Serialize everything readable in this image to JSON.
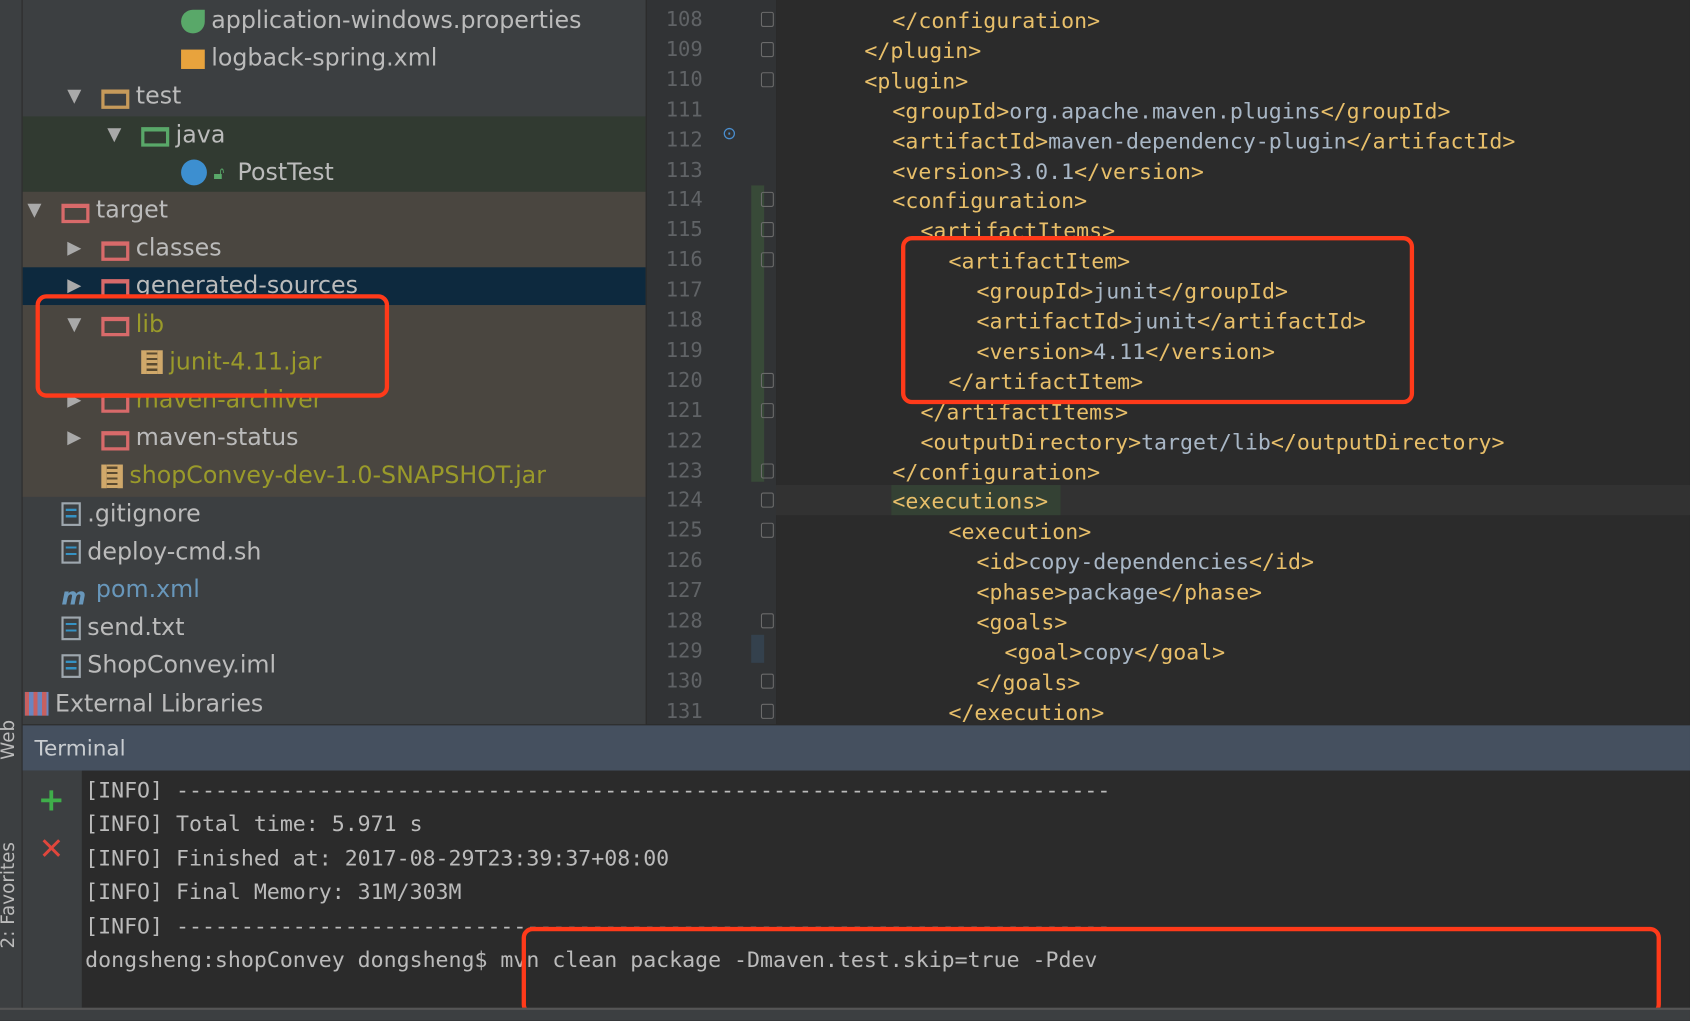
{
  "side_tools": {
    "web": "Web",
    "favorites": "2: Favorites"
  },
  "project_tree": [
    {
      "label": "application-windows.properties",
      "depth": 3,
      "icon": "spring-properties-icon",
      "arrow": "",
      "color": ""
    },
    {
      "label": "logback-spring.xml",
      "depth": 3,
      "icon": "xml-file-icon",
      "arrow": "",
      "color": ""
    },
    {
      "label": "test",
      "depth": 1,
      "icon": "folder-tan-icon",
      "arrow": "down",
      "color": ""
    },
    {
      "label": "java",
      "depth": 2,
      "icon": "folder-green-icon",
      "arrow": "down",
      "color": ""
    },
    {
      "label": "PostTest",
      "depth": 3,
      "icon": "test-class-icon",
      "arrow": "",
      "color": ""
    },
    {
      "label": "target",
      "depth": 0,
      "icon": "folder-red-icon",
      "arrow": "down",
      "color": ""
    },
    {
      "label": "classes",
      "depth": 1,
      "icon": "folder-red-icon",
      "arrow": "right",
      "color": ""
    },
    {
      "label": "generated-sources",
      "depth": 1,
      "icon": "folder-red-icon",
      "arrow": "right",
      "color": ""
    },
    {
      "label": "lib",
      "depth": 1,
      "icon": "folder-red-icon",
      "arrow": "down",
      "color": "olive"
    },
    {
      "label": "junit-4.11.jar",
      "depth": 2,
      "icon": "jar-icon",
      "arrow": "",
      "color": "olive"
    },
    {
      "label": "maven-archiver",
      "depth": 1,
      "icon": "folder-red-icon",
      "arrow": "right",
      "color": "olive"
    },
    {
      "label": "maven-status",
      "depth": 1,
      "icon": "folder-red-icon",
      "arrow": "right",
      "color": ""
    },
    {
      "label": "shopConvey-dev-1.0-SNAPSHOT.jar",
      "depth": 1,
      "icon": "jar-icon",
      "arrow": "",
      "color": "olive",
      "noarrow_slot": true
    },
    {
      "label": ".gitignore",
      "depth": 0,
      "icon": "text-file-icon",
      "arrow": "",
      "color": ""
    },
    {
      "label": "deploy-cmd.sh",
      "depth": 0,
      "icon": "text-file-icon",
      "arrow": "",
      "color": ""
    },
    {
      "label": "pom.xml",
      "depth": 0,
      "icon": "maven-icon",
      "arrow": "",
      "color": "blue"
    },
    {
      "label": "send.txt",
      "depth": 0,
      "icon": "text-file-icon",
      "arrow": "",
      "color": ""
    },
    {
      "label": "ShopConvey.iml",
      "depth": 0,
      "icon": "iml-file-icon",
      "arrow": "",
      "color": ""
    },
    {
      "label": "External Libraries",
      "depth": -1,
      "icon": "library-icon",
      "arrow": "",
      "color": ""
    }
  ],
  "code_lines": [
    {
      "n": "108",
      "indent": 1,
      "parts": [
        [
          "tag",
          "</configuration>"
        ]
      ]
    },
    {
      "n": "109",
      "indent": 0,
      "parts": [
        [
          "tag",
          "</plugin>"
        ]
      ]
    },
    {
      "n": "110",
      "indent": 0,
      "parts": [
        [
          "tag",
          "<plugin>"
        ]
      ]
    },
    {
      "n": "111",
      "indent": 1,
      "parts": [
        [
          "tag",
          "<groupId>"
        ],
        [
          "txt",
          "org.apache.maven.plugins"
        ],
        [
          "tag",
          "</groupId>"
        ]
      ]
    },
    {
      "n": "112",
      "indent": 1,
      "parts": [
        [
          "tag",
          "<artifactId>"
        ],
        [
          "txt",
          "maven-dependency-plugin"
        ],
        [
          "tag",
          "</artifactId>"
        ]
      ]
    },
    {
      "n": "113",
      "indent": 1,
      "parts": [
        [
          "tag",
          "<version>"
        ],
        [
          "txt",
          "3.0.1"
        ],
        [
          "tag",
          "</version>"
        ]
      ]
    },
    {
      "n": "114",
      "indent": 1,
      "parts": [
        [
          "tag",
          "<configuration>"
        ]
      ]
    },
    {
      "n": "115",
      "indent": 2,
      "parts": [
        [
          "tag",
          "<artifactItems>"
        ]
      ]
    },
    {
      "n": "116",
      "indent": 3,
      "parts": [
        [
          "tag",
          "<artifactItem>"
        ]
      ]
    },
    {
      "n": "117",
      "indent": 4,
      "parts": [
        [
          "tag",
          "<groupId>"
        ],
        [
          "txt",
          "junit"
        ],
        [
          "tag",
          "</groupId>"
        ]
      ]
    },
    {
      "n": "118",
      "indent": 4,
      "parts": [
        [
          "tag",
          "<artifactId>"
        ],
        [
          "txt",
          "junit"
        ],
        [
          "tag",
          "</artifactId>"
        ]
      ]
    },
    {
      "n": "119",
      "indent": 4,
      "parts": [
        [
          "tag",
          "<version>"
        ],
        [
          "txt",
          "4.11"
        ],
        [
          "tag",
          "</version>"
        ]
      ]
    },
    {
      "n": "120",
      "indent": 3,
      "parts": [
        [
          "tag",
          "</artifactItem>"
        ]
      ]
    },
    {
      "n": "121",
      "indent": 2,
      "parts": [
        [
          "tag",
          "</artifactItems>"
        ]
      ]
    },
    {
      "n": "122",
      "indent": 2,
      "parts": [
        [
          "tag",
          "<outputDirectory>"
        ],
        [
          "txt",
          "target/lib"
        ],
        [
          "tag",
          "</outputDirectory>"
        ]
      ]
    },
    {
      "n": "123",
      "indent": 1,
      "parts": [
        [
          "tag",
          "</configuration>"
        ]
      ]
    },
    {
      "n": "124",
      "indent": 1,
      "parts": [
        [
          "tag",
          "<executions>"
        ]
      ]
    },
    {
      "n": "125",
      "indent": 3,
      "parts": [
        [
          "tag",
          "<execution>"
        ]
      ]
    },
    {
      "n": "126",
      "indent": 4,
      "parts": [
        [
          "tag",
          "<id>"
        ],
        [
          "txt",
          "copy-dependencies"
        ],
        [
          "tag",
          "</id>"
        ]
      ]
    },
    {
      "n": "127",
      "indent": 4,
      "parts": [
        [
          "tag",
          "<phase>"
        ],
        [
          "txt",
          "package"
        ],
        [
          "tag",
          "</phase>"
        ]
      ]
    },
    {
      "n": "128",
      "indent": 4,
      "parts": [
        [
          "tag",
          "<goals>"
        ]
      ]
    },
    {
      "n": "129",
      "indent": 5,
      "parts": [
        [
          "tag",
          "<goal>"
        ],
        [
          "txt",
          "copy"
        ],
        [
          "tag",
          "</goal>"
        ]
      ]
    },
    {
      "n": "130",
      "indent": 4,
      "parts": [
        [
          "tag",
          "</goals>"
        ]
      ]
    },
    {
      "n": "131",
      "indent": 3,
      "parts": [
        [
          "tag",
          "</execution>"
        ]
      ]
    }
  ],
  "terminal": {
    "title": "Terminal",
    "lines": [
      "[INFO] ------------------------------------------------------------------------",
      "[INFO] Total time: 5.971 s",
      "[INFO] Finished at: 2017-08-29T23:39:37+08:00",
      "[INFO] Final Memory: 31M/303M",
      "[INFO] ------------------------------------------------------------------------"
    ],
    "prompt": "dongsheng:shopConvey dongsheng$ ",
    "command": "mvn clean package -Dmaven.test.skip=true -Pdev"
  },
  "colors": {
    "highlight_box": "#ff3a1a",
    "xml_tag": "#e8bf6a",
    "xml_text": "#a9b7c6",
    "excluded": "#9a9a2a"
  }
}
